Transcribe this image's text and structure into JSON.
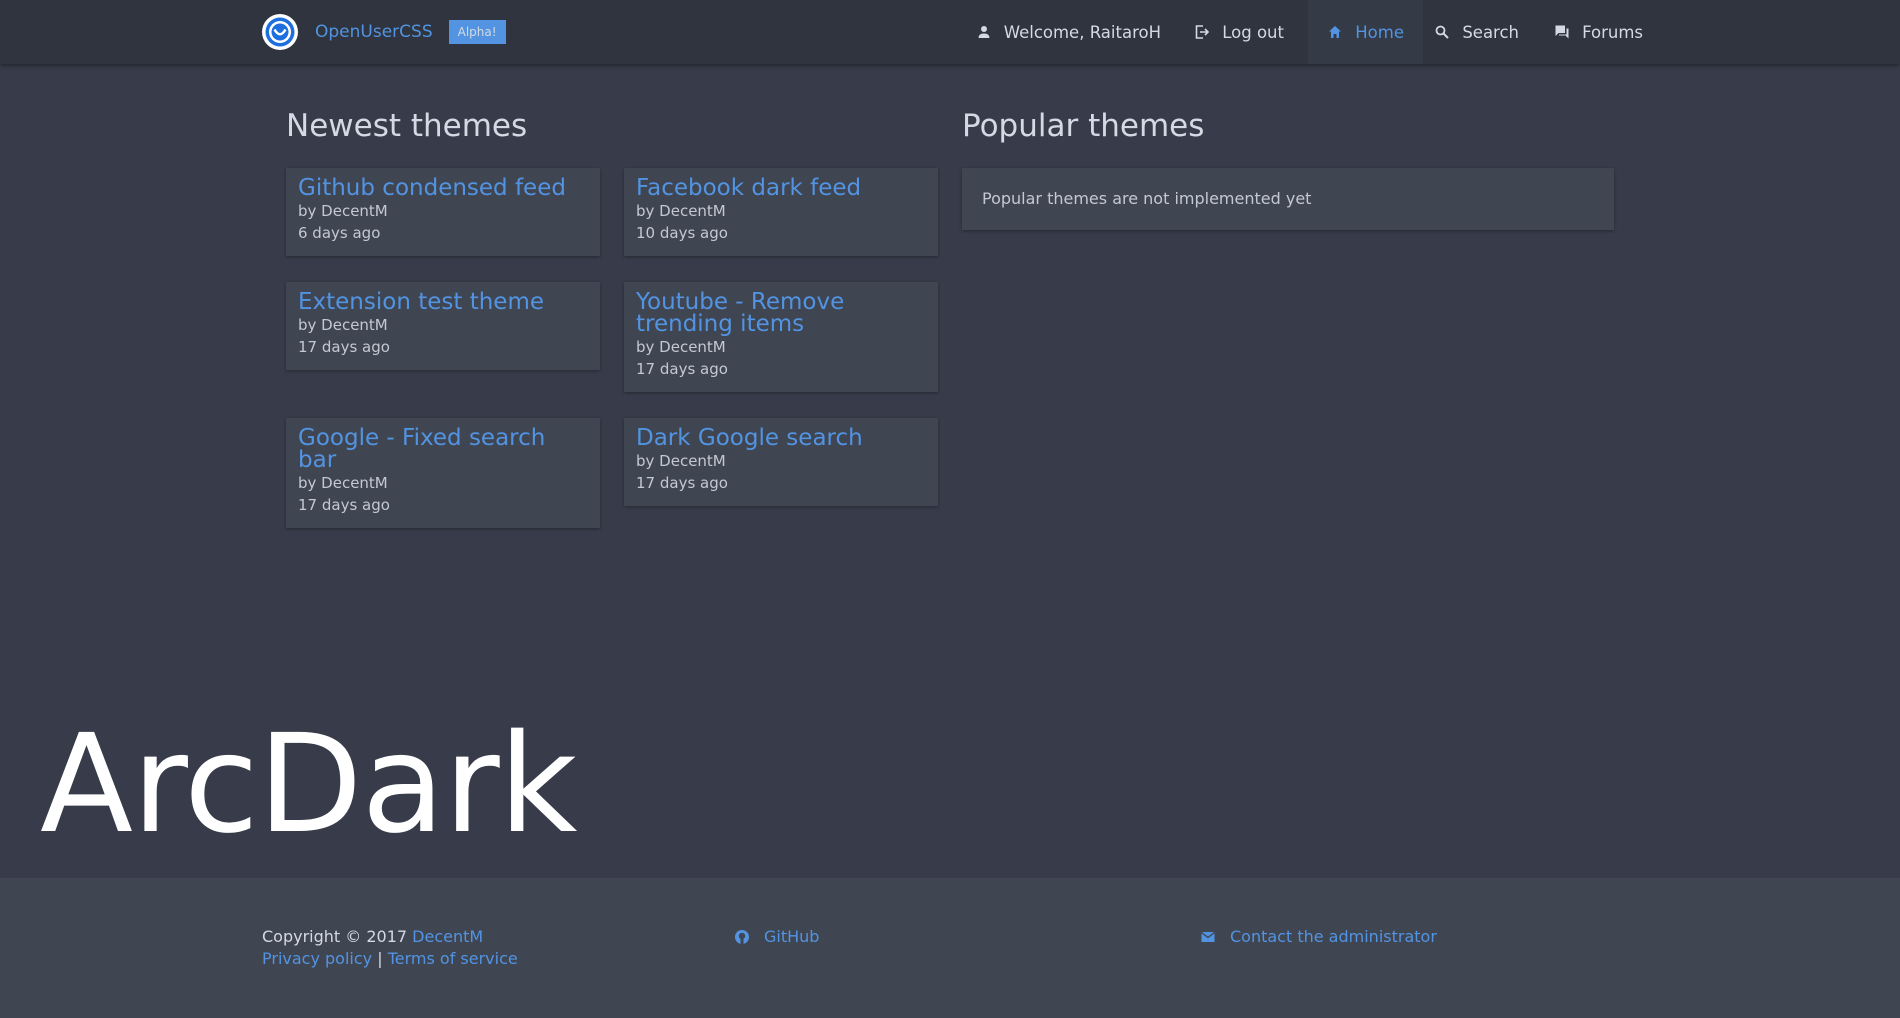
{
  "header": {
    "brand_name": "OpenUserCSS",
    "badge": "Alpha!",
    "nav": {
      "welcome": "Welcome, RaitaroH",
      "logout": "Log out",
      "home": "Home",
      "search": "Search",
      "forums": "Forums"
    },
    "icons": {
      "welcome": "user-icon",
      "logout": "logout-icon",
      "home": "home-icon",
      "search": "search-icon",
      "forums": "forum-icon"
    },
    "active_nav": "home"
  },
  "newest": {
    "title": "Newest themes",
    "themes": [
      {
        "title": "Github condensed feed",
        "author": "by DecentM",
        "time": "6 days ago"
      },
      {
        "title": "Facebook dark feed",
        "author": "by DecentM",
        "time": "10 days ago"
      },
      {
        "title": "Extension test theme",
        "author": "by DecentM",
        "time": "17 days ago"
      },
      {
        "title": "Youtube - Remove trending items",
        "author": "by DecentM",
        "time": "17 days ago"
      },
      {
        "title": "Google - Fixed search bar",
        "author": "by DecentM",
        "time": "17 days ago"
      },
      {
        "title": "Dark Google search",
        "author": "by DecentM",
        "time": "17 days ago"
      }
    ]
  },
  "popular": {
    "title": "Popular themes",
    "message": "Popular themes are not implemented yet"
  },
  "watermark": "ArcDark",
  "footer": {
    "copyright": "Copyright © 2017",
    "copyright_link": "DecentM",
    "privacy": "Privacy policy",
    "separator": "|",
    "terms": "Terms of service",
    "github": "GitHub",
    "contact": "Contact the administrator"
  },
  "colors": {
    "background": "#383c4a",
    "header": "#2f343f",
    "card": "#404552",
    "accent": "#5294e2",
    "text": "#d3dae3"
  }
}
